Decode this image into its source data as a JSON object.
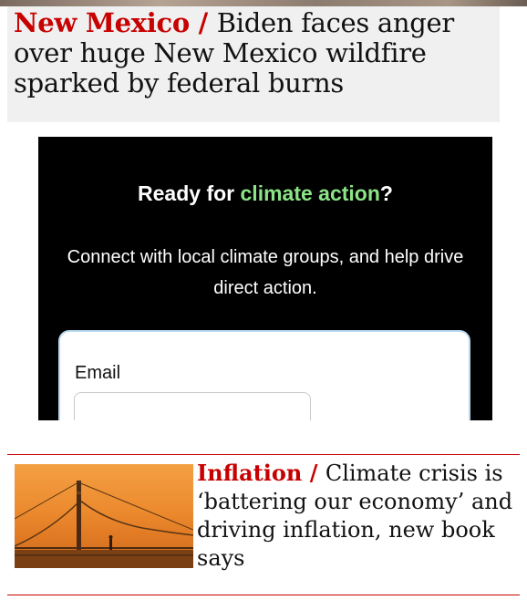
{
  "top_story": {
    "kicker": "New Mexico",
    "separator": " / ",
    "headline": "Biden faces anger over huge New Mexico wildfire sparked by federal burns"
  },
  "signup": {
    "title_prefix": "Ready for ",
    "title_accent": "climate action",
    "title_suffix": "?",
    "description": "Connect with local climate groups, and help drive direct action.",
    "email_label": "Email",
    "email_value": "",
    "accent_color": "#8be486"
  },
  "story_row": {
    "kicker": "Inflation",
    "separator": " / ",
    "headline": "Climate crisis is ‘battering our economy’ and driving inflation, new book says",
    "image_icon": "bridge-photo"
  },
  "colors": {
    "kicker": "#c70000",
    "panel_bg": "#f0f0f0",
    "signup_bg": "#000000"
  }
}
